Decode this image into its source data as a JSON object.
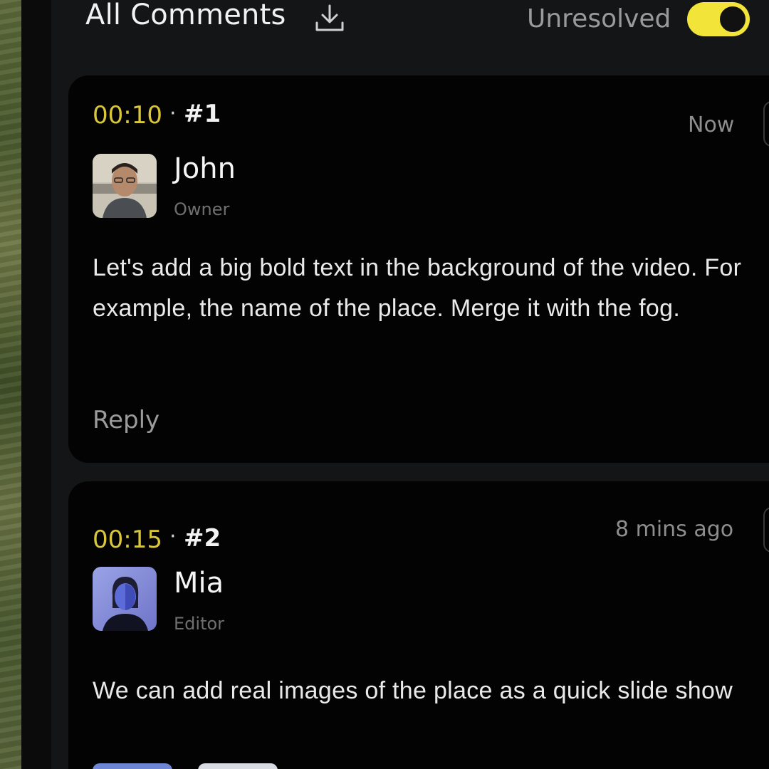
{
  "header": {
    "title": "All Comments",
    "filter_label": "Unresolved",
    "filter_on": true,
    "accent_color": "#f3e43a"
  },
  "icons": {
    "download": "download-icon",
    "toggle": "toggle-switch"
  },
  "comments": [
    {
      "timecode": "00:10",
      "separator": "·",
      "number": "#1",
      "time_ago": "Now",
      "author": "John",
      "role": "Owner",
      "text": "Let's add a big bold text in the background of the video. For example, the name of the place. Merge it with the fog.",
      "reply_label": "Reply"
    },
    {
      "timecode": "00:15",
      "separator": "·",
      "number": "#2",
      "time_ago": "8 mins ago",
      "author": "Mia",
      "role": "Editor",
      "text": "We can add real images of the place as a quick slide show"
    }
  ]
}
